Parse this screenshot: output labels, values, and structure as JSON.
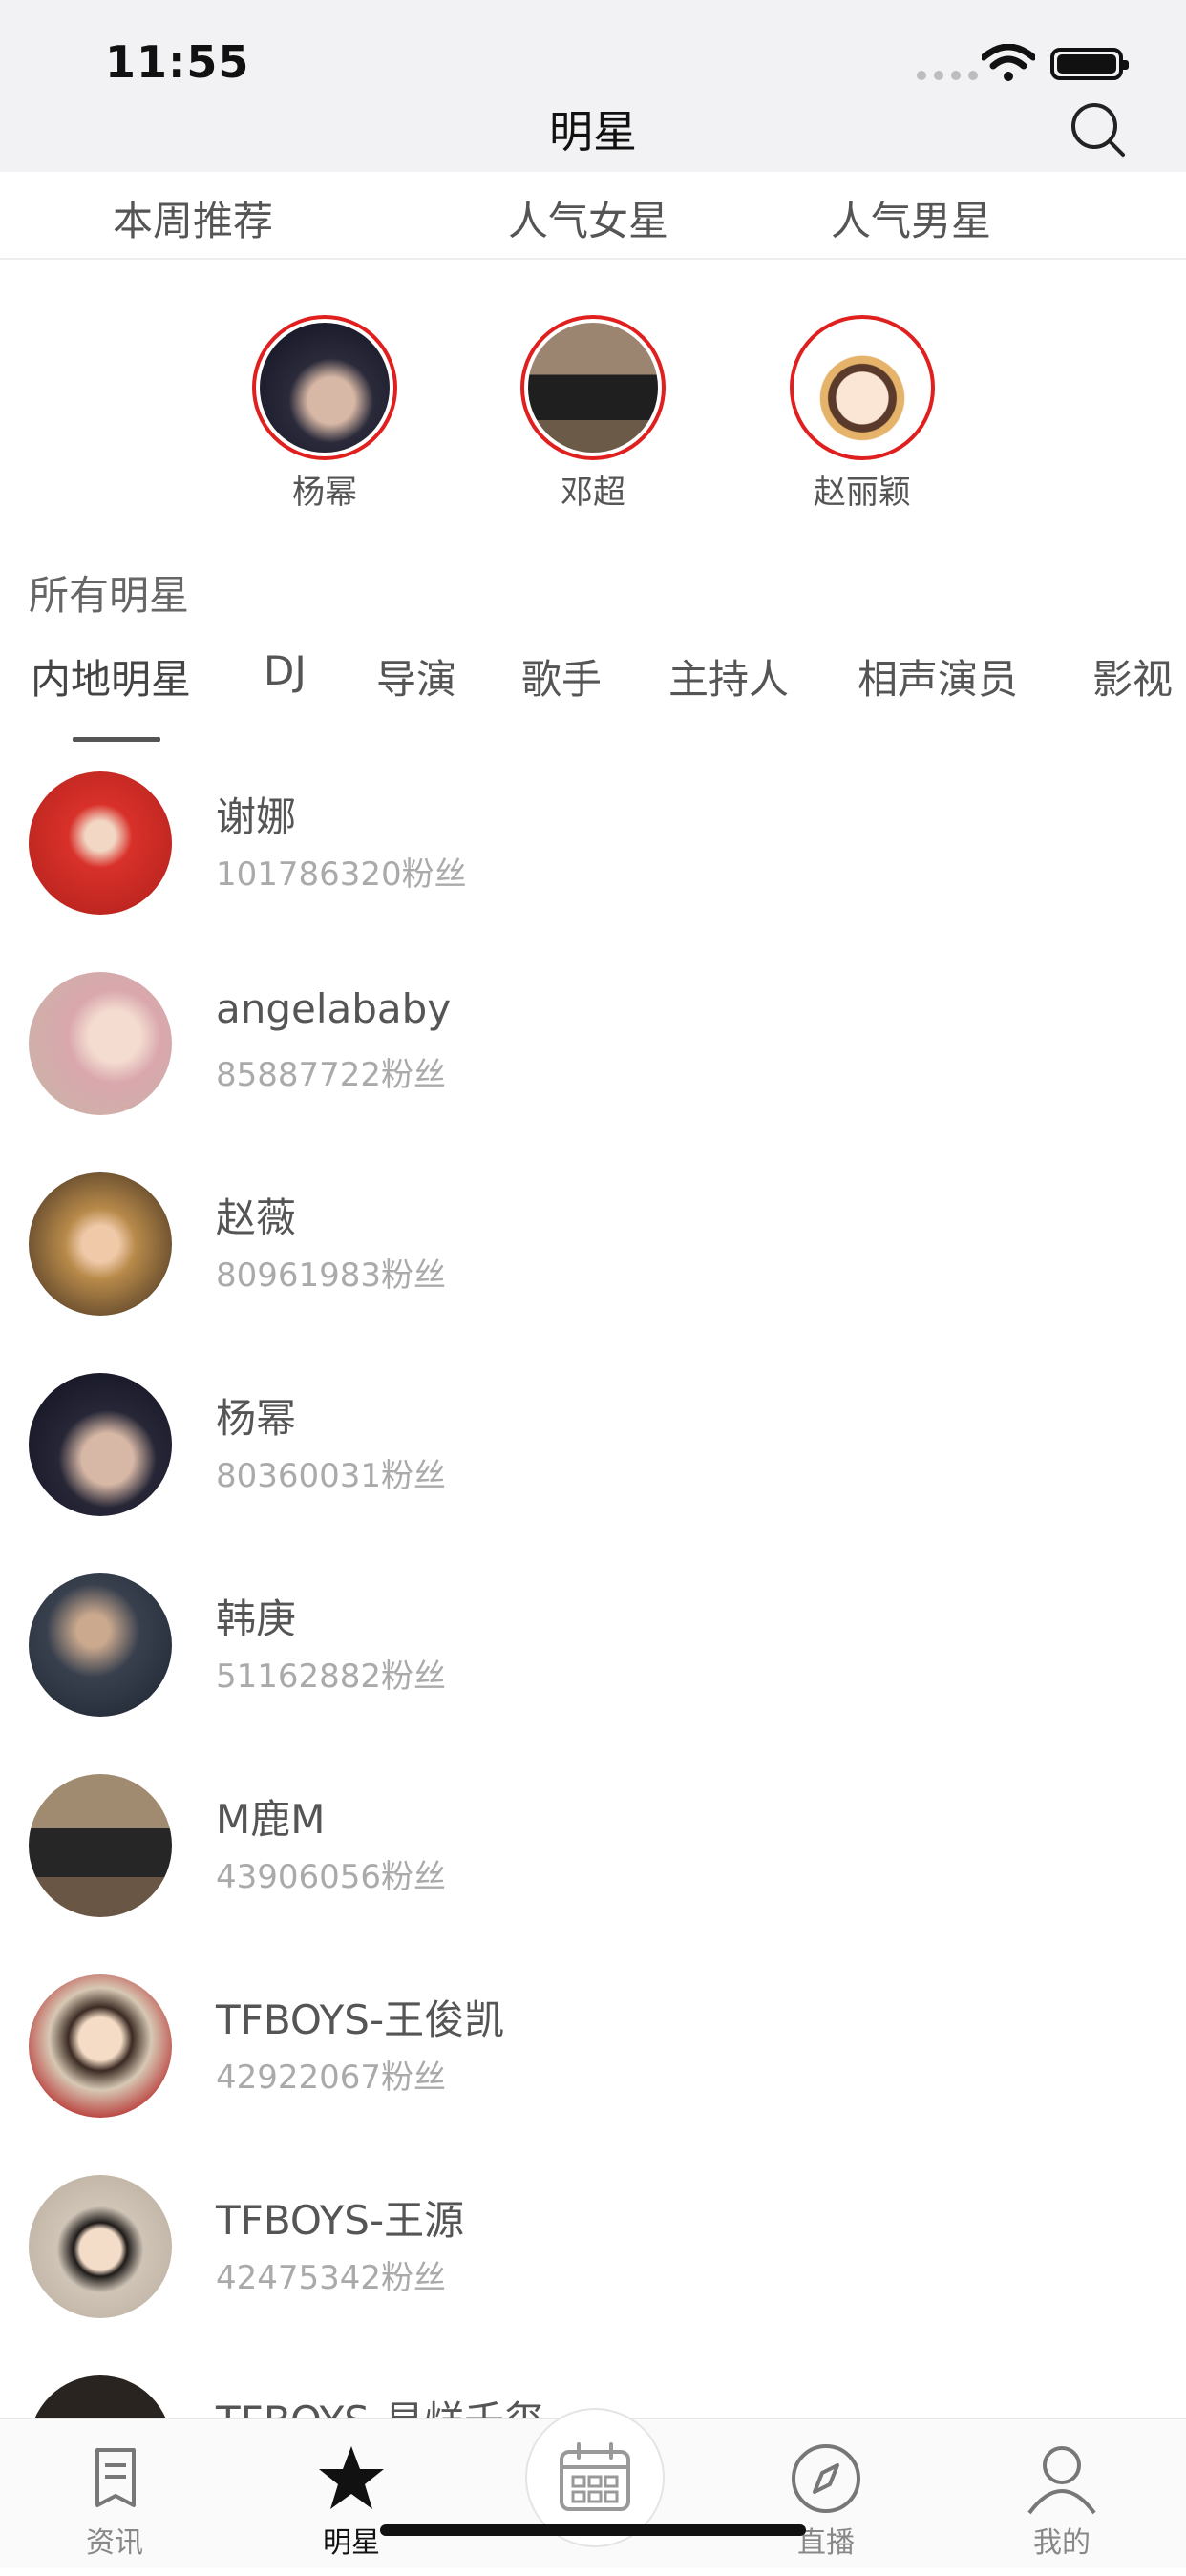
{
  "status": {
    "time": "11:55"
  },
  "nav": {
    "title": "明星"
  },
  "tabs": [
    "本周推荐",
    "人气女星",
    "人气男星"
  ],
  "featured": [
    {
      "name": "杨幂",
      "color": "#2a2a3a"
    },
    {
      "name": "邓超",
      "color": "#6b5a48"
    },
    {
      "name": "赵丽颖",
      "color": "#f6e5d8"
    }
  ],
  "section": {
    "title": "所有明星"
  },
  "categories": [
    "内地明星",
    "DJ",
    "导演",
    "歌手",
    "主持人",
    "相声演员",
    "影视"
  ],
  "stars": [
    {
      "name": "谢娜",
      "fans": "101786320粉丝",
      "color": "#d8312a"
    },
    {
      "name": "angelababy",
      "fans": "85887722粉丝",
      "color": "#e9c2c4"
    },
    {
      "name": "赵薇",
      "fans": "80961983粉丝",
      "color": "#5b4230"
    },
    {
      "name": "杨幂",
      "fans": "80360031粉丝",
      "color": "#262636"
    },
    {
      "name": "韩庚",
      "fans": "51162882粉丝",
      "color": "#38404e"
    },
    {
      "name": "M鹿M",
      "fans": "43906056粉丝",
      "color": "#6a5644"
    },
    {
      "name": "TFBOYS-王俊凯",
      "fans": "42922067粉丝",
      "color": "#d7c8b4"
    },
    {
      "name": "TFBOYS-王源",
      "fans": "42475342粉丝",
      "color": "#cfc4b6"
    },
    {
      "name": "TFBOYS-易烊千玺",
      "fans": "",
      "color": "#2a2420"
    }
  ],
  "tabbar": [
    {
      "label": "资讯",
      "icon": "news-icon"
    },
    {
      "label": "明星",
      "icon": "star-icon"
    },
    {
      "label": "",
      "icon": "calendar-icon"
    },
    {
      "label": "直播",
      "icon": "compass-icon"
    },
    {
      "label": "我的",
      "icon": "profile-icon"
    }
  ],
  "colors": {
    "accent_ring": "#e0201e",
    "text_secondary": "#aaaaaa"
  }
}
